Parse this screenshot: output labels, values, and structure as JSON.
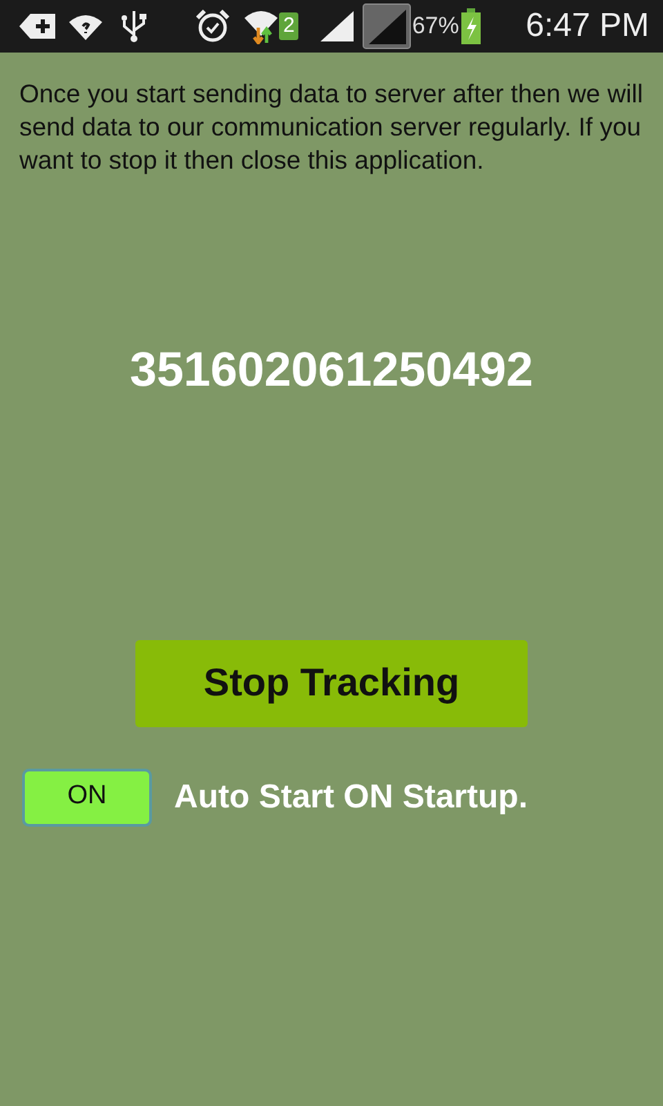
{
  "status_bar": {
    "sim_badge": "2",
    "battery_percent": "67%",
    "time": "6:47 PM"
  },
  "message": "Once you start sending data to server after then we will send data to our communication server regularly. If you want to stop it then close this application.",
  "device_id": "351602061250492",
  "tracking_button": {
    "label": "Stop Tracking"
  },
  "auto_start": {
    "toggle_label": "ON",
    "on": true,
    "label": "Auto Start ON Startup."
  }
}
